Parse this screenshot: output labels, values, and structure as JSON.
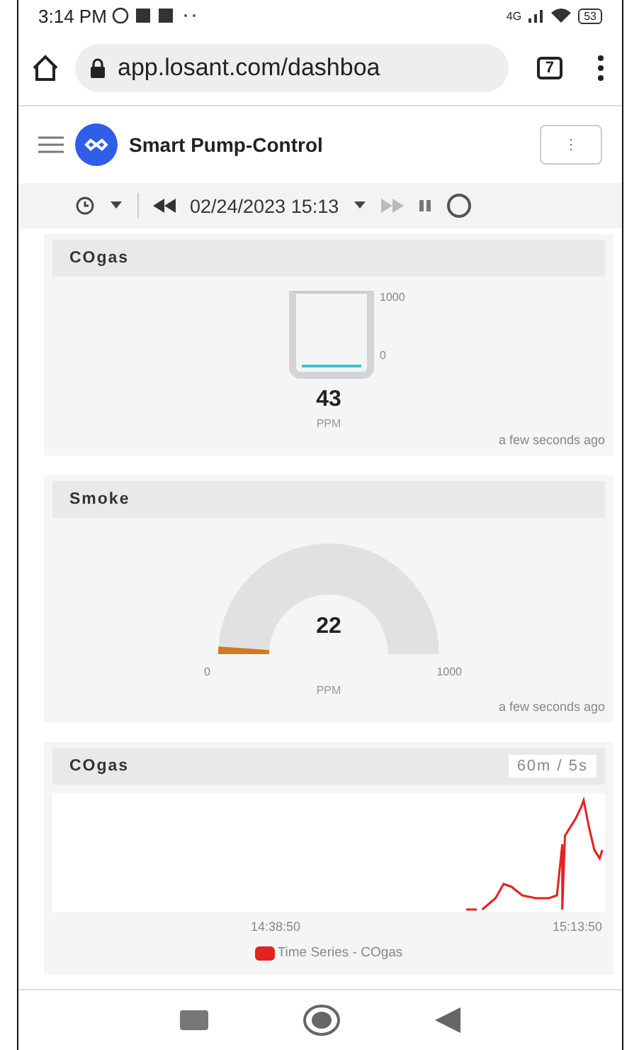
{
  "status_bar": {
    "time": "3:14 PM",
    "network": "4G",
    "battery": "53"
  },
  "browser": {
    "url": "app.losant.com/dashboa",
    "tab_count": "7"
  },
  "app_header": {
    "title": "Smart Pump-Control",
    "menu_button": "⋮"
  },
  "time_bar": {
    "date": "02/24/2023 15:13"
  },
  "widgets": [
    {
      "kind": "tank",
      "title": "COgas",
      "max": "1000",
      "min": "0",
      "value": "43",
      "unit": "PPM",
      "updated": "a few seconds ago"
    },
    {
      "kind": "gauge",
      "title": "Smoke",
      "min": "0",
      "max": "1000",
      "value": "22",
      "unit": "PPM",
      "updated": "a few seconds ago"
    },
    {
      "kind": "chart",
      "title": "COgas",
      "range": "60m / 5s",
      "xlabels": [
        "14:38:50",
        "15:13:50"
      ],
      "legend": "Time Series - COgas",
      "color": "#e52222"
    }
  ]
}
